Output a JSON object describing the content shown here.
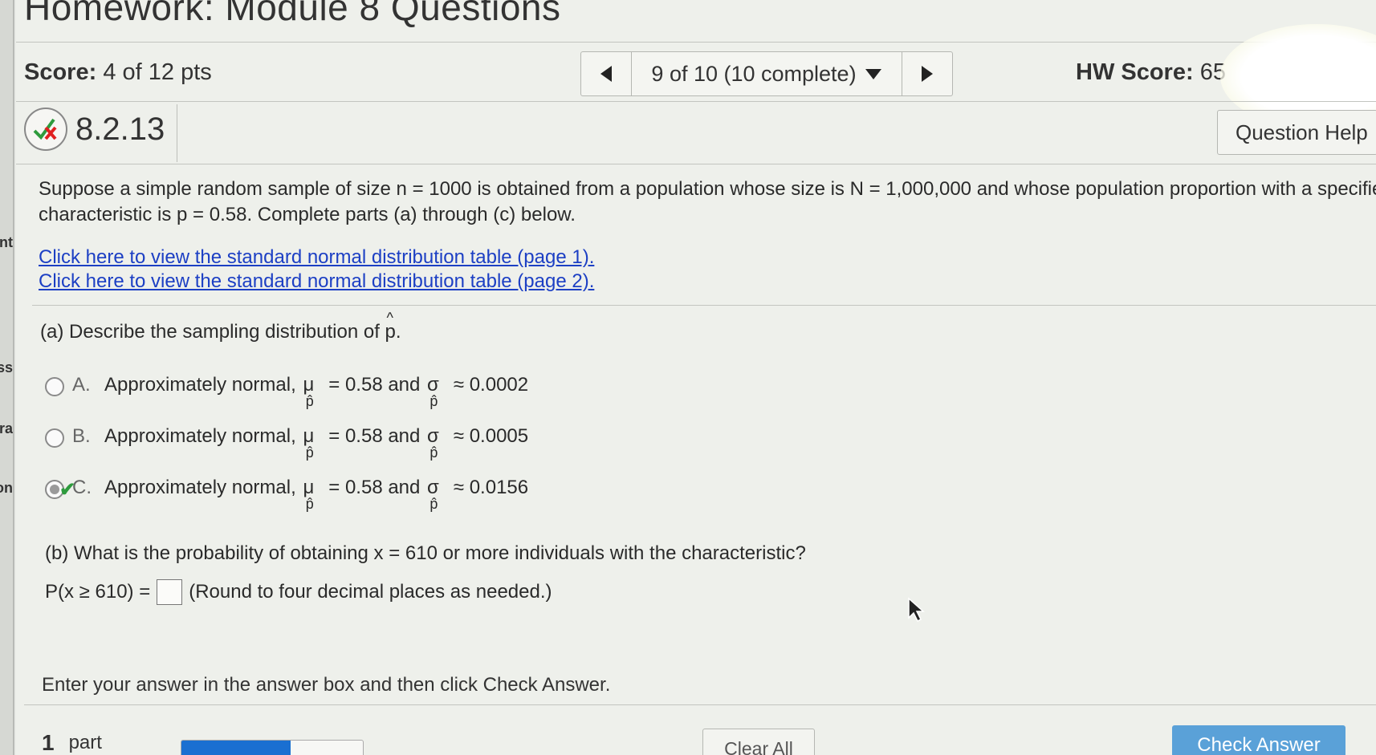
{
  "page": {
    "module_title": "Homework: Module 8 Questions"
  },
  "left_fragments": [
    "nt",
    "ss",
    "ra",
    "on"
  ],
  "header": {
    "score_label": "Score:",
    "score_value": "4 of 12 pts",
    "nav_status": "9 of 10 (10 complete)",
    "hw_score_label": "HW Score:",
    "hw_score_value": "65"
  },
  "question": {
    "id": "8.2.13",
    "help_label": "Question Help",
    "text_line1": "Suppose a simple random sample of size n = 1000 is obtained from a population whose size is N = 1,000,000 and whose population proportion with a specified",
    "text_line2": "characteristic is p = 0.58. Complete parts (a) through (c) below.",
    "link1": "Click here to view the standard normal distribution table (page 1).",
    "link2": "Click here to view the standard normal distribution table (page 2)."
  },
  "part_a": {
    "prompt_prefix": "(a) Describe the sampling distribution of",
    "phat": "p",
    "options": [
      {
        "letter": "A.",
        "text_pre": "Approximately normal,",
        "mu_value": "= 0.58 and",
        "sigma_value": "≈ 0.0002",
        "selected": false
      },
      {
        "letter": "B.",
        "text_pre": "Approximately normal,",
        "mu_value": "= 0.58 and",
        "sigma_value": "≈ 0.0005",
        "selected": false
      },
      {
        "letter": "C.",
        "text_pre": "Approximately normal,",
        "mu_value": "= 0.58 and",
        "sigma_value": "≈ 0.0156",
        "selected": true
      }
    ],
    "mu_symbol": "μ",
    "sigma_symbol": "σ",
    "hat_sub": "p̂"
  },
  "part_b": {
    "prompt": "(b) What is the probability of obtaining x = 610 or more individuals with the characteristic?",
    "prob_label": "P(x ≥ 610) =",
    "hint": "(Round to four decimal places as needed.)"
  },
  "footer": {
    "instruction": "Enter your answer in the answer box and then click Check Answer.",
    "parts_count": "1",
    "parts_label": "part",
    "progress_fraction": 0.6,
    "clear_label": "Clear All",
    "check_label": "Check Answer"
  },
  "colors": {
    "link": "#1c3fc4",
    "check_button": "#5aa1d8",
    "progress": "#1a6fd1",
    "correct": "#2e9b3d",
    "incorrect": "#e02020"
  }
}
